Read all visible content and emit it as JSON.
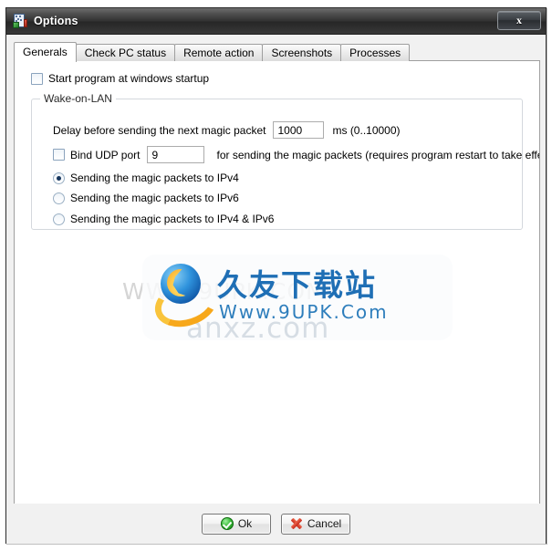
{
  "window": {
    "title": "Options",
    "icon": "options-app-icon",
    "close_label": "x"
  },
  "tabs": [
    {
      "label": "Generals",
      "selected": true
    },
    {
      "label": "Check PC status",
      "selected": false
    },
    {
      "label": "Remote action",
      "selected": false
    },
    {
      "label": "Screenshots",
      "selected": false
    },
    {
      "label": "Processes",
      "selected": false
    }
  ],
  "generals": {
    "startup_checkbox": {
      "label": "Start program at windows startup",
      "checked": false
    },
    "group": {
      "title": "Wake-on-LAN",
      "delay": {
        "label": "Delay before sending the next magic packet",
        "value": "1000",
        "unit": "ms  (0..10000)"
      },
      "udp": {
        "checkbox_label": "Bind UDP port",
        "checked": false,
        "value": "9",
        "suffix": "for sending the magic packets (requires program restart to take effect)"
      },
      "radios": [
        {
          "label": "Sending the magic packets to IPv4",
          "checked": true
        },
        {
          "label": "Sending the magic packets to IPv6",
          "checked": false
        },
        {
          "label": "Sending the magic packets to IPv4 & IPv6",
          "checked": false
        }
      ]
    }
  },
  "watermark": {
    "background_text": "WWW.9UPK.COM",
    "background_text2": "anxz.com",
    "chinese_title": "久友下载站",
    "url": "Www.9UPK.Com"
  },
  "buttons": {
    "ok": "Ok",
    "cancel": "Cancel"
  },
  "colors": {
    "accent": "#17365d",
    "titlebar": "#2e2e2e",
    "ok_green": "#128512",
    "cancel_red": "#c5291a",
    "logo_blue": "#1f6fb5"
  }
}
